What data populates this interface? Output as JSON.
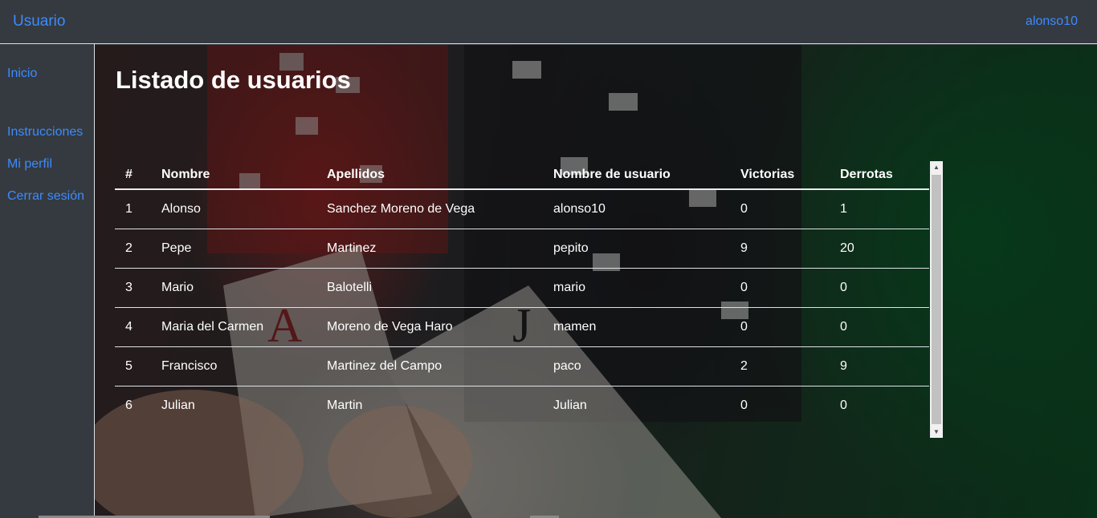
{
  "navbar": {
    "brand": "Usuario",
    "user": "alonso10"
  },
  "sidebar": {
    "items": [
      {
        "label": "Inicio"
      },
      {
        "label": "Instrucciones"
      },
      {
        "label": "Mi perfil"
      },
      {
        "label": "Cerrar sesión"
      }
    ]
  },
  "main": {
    "title": "Listado de usuarios",
    "table": {
      "headers": [
        "#",
        "Nombre",
        "Apellidos",
        "Nombre de usuario",
        "Victorias",
        "Derrotas"
      ],
      "rows": [
        [
          "1",
          "Alonso",
          "Sanchez Moreno de Vega",
          "alonso10",
          "0",
          "1"
        ],
        [
          "2",
          "Pepe",
          "Martinez",
          "pepito",
          "9",
          "20"
        ],
        [
          "3",
          "Mario",
          "Balotelli",
          "mario",
          "0",
          "0"
        ],
        [
          "4",
          "Maria del Carmen",
          "Moreno de Vega Haro",
          "mamen",
          "0",
          "0"
        ],
        [
          "5",
          "Francisco",
          "Martinez del Campo",
          "paco",
          "2",
          "9"
        ],
        [
          "6",
          "Julian",
          "Martin",
          "Julian",
          "0",
          "0"
        ]
      ]
    }
  },
  "icons": {
    "scroll_up": "scroll-up-arrow-icon",
    "scroll_down": "scroll-down-arrow-icon"
  },
  "colors": {
    "link": "#3d8bfd",
    "navbar_bg": "#343a40",
    "text": "#ffffff"
  }
}
